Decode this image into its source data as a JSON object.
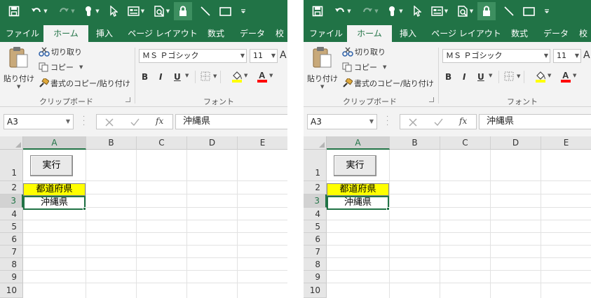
{
  "panes": [
    {
      "tabs": [
        "ファイル",
        "ホーム",
        "挿入",
        "ページ レイアウト",
        "数式",
        "データ",
        "校"
      ],
      "clipboard": {
        "paste": "貼り付け",
        "cut": "切り取り",
        "copy": "コピー",
        "format_painter": "書式のコピー/貼り付け",
        "group_label": "クリップボード"
      },
      "font": {
        "name": "ＭＳ Ｐゴシック",
        "size": "11",
        "grow": "A",
        "bold": "B",
        "italic": "I",
        "underline": "U",
        "group_label": "フォント"
      },
      "formula_bar": {
        "name_box": "A3",
        "fx": "fx",
        "content": "沖縄県"
      },
      "columns": [
        "A",
        "B",
        "C",
        "D",
        "E"
      ],
      "rows": [
        "1",
        "2",
        "3",
        "4",
        "5",
        "6",
        "7",
        "8",
        "9",
        "10"
      ],
      "button_label": "実行",
      "cells": {
        "A2": "都道府県",
        "A3": "沖縄県"
      }
    },
    {
      "tabs": [
        "ファイル",
        "ホーム",
        "挿入",
        "ページ レイアウト",
        "数式",
        "データ",
        "校"
      ],
      "clipboard": {
        "paste": "貼り付け",
        "cut": "切り取り",
        "copy": "コピー",
        "format_painter": "書式のコピー/貼り付け",
        "group_label": "クリップボード"
      },
      "font": {
        "name": "ＭＳ Ｐゴシック",
        "size": "11",
        "grow": "A",
        "bold": "B",
        "italic": "I",
        "underline": "U",
        "group_label": "フォント"
      },
      "formula_bar": {
        "name_box": "A3",
        "fx": "fx",
        "content": "沖縄県"
      },
      "columns": [
        "A",
        "B",
        "C",
        "D",
        "E"
      ],
      "rows": [
        "1",
        "2",
        "3",
        "4",
        "5",
        "6",
        "7",
        "8",
        "9",
        "10"
      ],
      "button_label": "実行",
      "cells": {
        "A2": "都道府県",
        "A3": "沖縄県"
      }
    }
  ],
  "colors": {
    "accent": "#217346",
    "header_fill": "#ffff00",
    "font_color_bar": "#ff0000",
    "highlight_bar": "#ffff00"
  },
  "icons": [
    "save-icon",
    "undo-icon",
    "redo-icon",
    "touch-mode-icon",
    "select-objects-icon",
    "form-icon",
    "print-preview-icon",
    "lock-icon",
    "draw-line-icon",
    "rectangle-icon",
    "customize-qat-icon",
    "paste-icon",
    "scissors-icon",
    "copy-icon",
    "format-painter-icon",
    "border-icon",
    "fill-color-icon",
    "font-color-icon",
    "cancel-icon",
    "enter-icon"
  ]
}
